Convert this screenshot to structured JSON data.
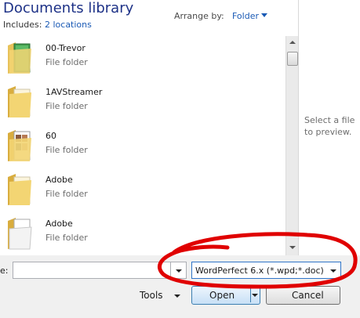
{
  "header": {
    "title": "Documents library",
    "includes_label": "Includes:",
    "includes_link": "2 locations",
    "arrange_label": "Arrange by:",
    "arrange_value": "Folder"
  },
  "items": [
    {
      "name": "00-Trevor",
      "type": "File folder",
      "icon": "folder-green-icon"
    },
    {
      "name": "1AVStreamer",
      "type": "File folder",
      "icon": "folder-icon"
    },
    {
      "name": "60",
      "type": "File folder",
      "icon": "folder-with-images-icon"
    },
    {
      "name": "Adobe",
      "type": "File folder",
      "icon": "folder-icon"
    },
    {
      "name": "Adobe",
      "type": "File folder",
      "icon": "folder-with-document-icon"
    }
  ],
  "preview": {
    "text": "Select a file to preview."
  },
  "footer": {
    "filename_label": "e:",
    "filename_value": "",
    "filetype_value": "WordPerfect 6.x (*.wpd;*.doc)",
    "tools_label": "Tools",
    "open_label": "Open",
    "cancel_label": "Cancel"
  },
  "colors": {
    "title": "#1e3287",
    "link": "#1a5ab5",
    "annotation": "#e00000"
  }
}
